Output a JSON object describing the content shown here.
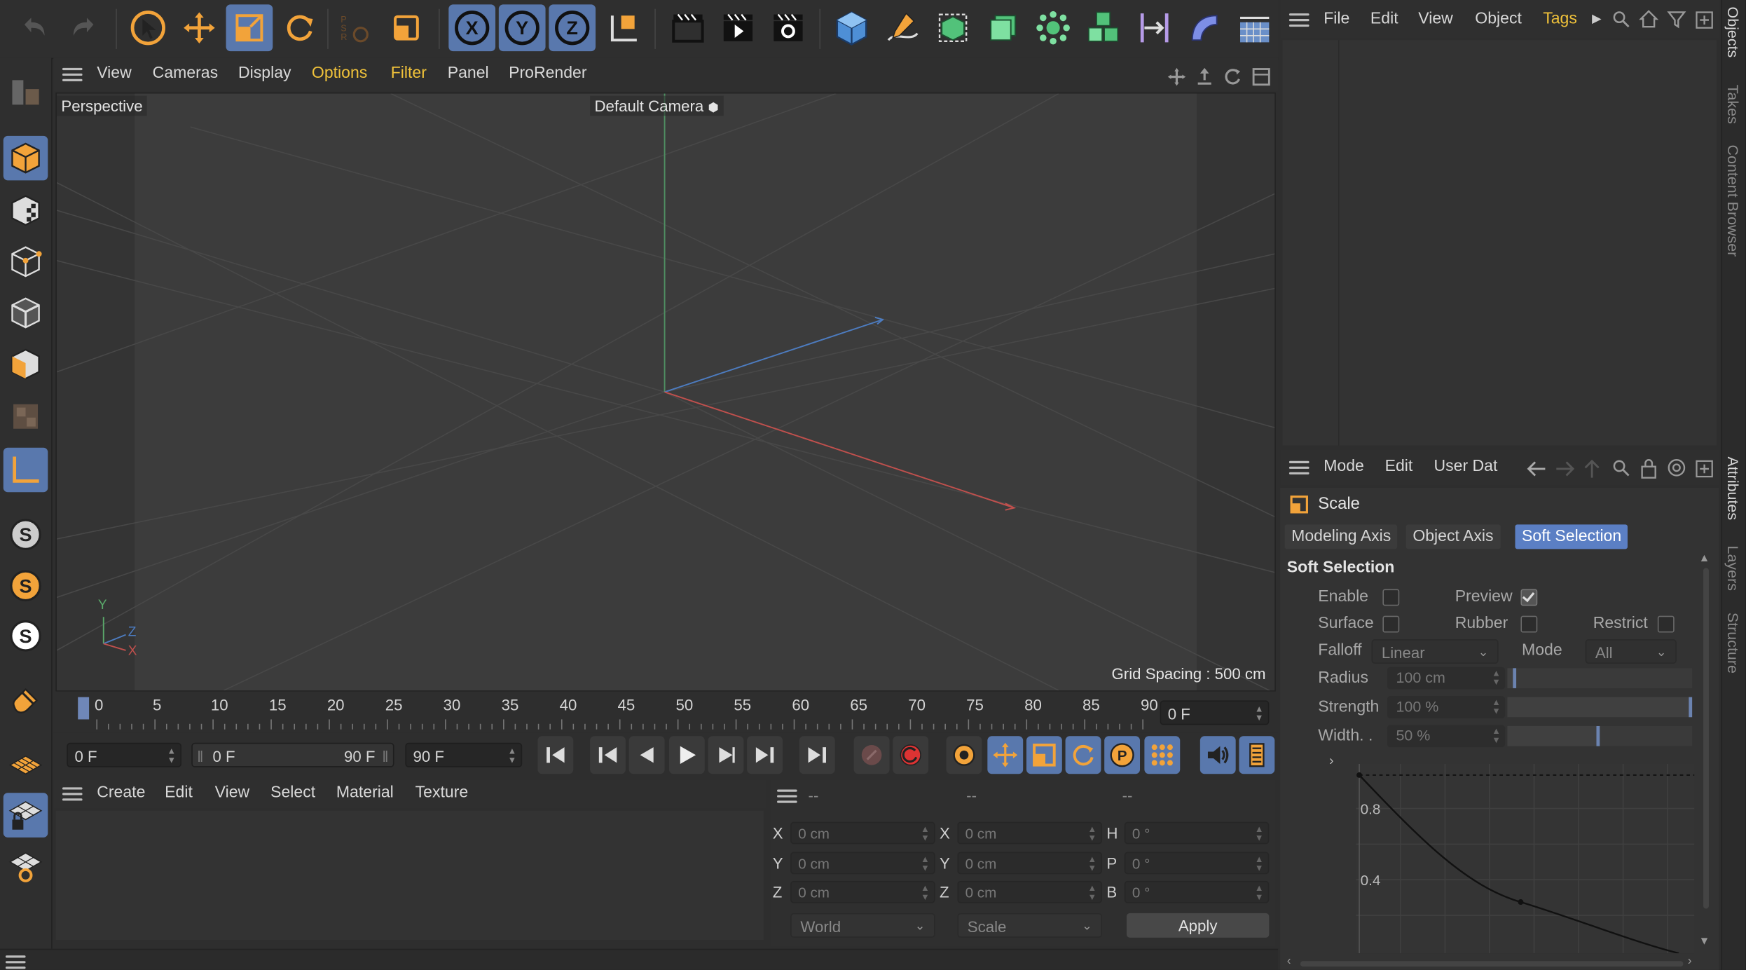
{
  "viewport": {
    "menu": [
      "View",
      "Cameras",
      "Display",
      "Options",
      "Filter",
      "Panel",
      "ProRender"
    ],
    "highlighted_menu": [
      "Options",
      "Filter"
    ],
    "view_name": "Perspective",
    "camera": "Default Camera",
    "grid_spacing": "Grid Spacing : 500 cm",
    "axis_labels": {
      "y": "Y",
      "z": "Z",
      "x": "X"
    }
  },
  "toolbar": {
    "mode_coords": [
      "X",
      "Y",
      "Z"
    ]
  },
  "timeline": {
    "ticks": [
      "0",
      "5",
      "10",
      "15",
      "20",
      "25",
      "30",
      "35",
      "40",
      "45",
      "50",
      "55",
      "60",
      "65",
      "70",
      "75",
      "80",
      "85",
      "90"
    ],
    "current_frame": "0 F"
  },
  "transport": {
    "start": "0 F",
    "range_start": "0 F",
    "range_end": "90 F",
    "end": "90 F"
  },
  "material_manager": {
    "menu": [
      "Create",
      "Edit",
      "View",
      "Select",
      "Material",
      "Texture"
    ]
  },
  "coordinates": {
    "headers": [
      "--",
      "--",
      "--"
    ],
    "rows": [
      {
        "l1": "X",
        "v1": "0 cm",
        "l2": "X",
        "v2": "0 cm",
        "l3": "H",
        "v3": "0 °"
      },
      {
        "l1": "Y",
        "v1": "0 cm",
        "l2": "Y",
        "v2": "0 cm",
        "l3": "P",
        "v3": "0 °"
      },
      {
        "l1": "Z",
        "v1": "0 cm",
        "l2": "Z",
        "v2": "0 cm",
        "l3": "B",
        "v3": "0 °"
      }
    ],
    "space": "World",
    "mode": "Scale",
    "apply": "Apply"
  },
  "object_manager": {
    "menu": [
      "File",
      "Edit",
      "View",
      "Object",
      "Tags"
    ],
    "highlighted_menu": "Tags"
  },
  "attributes": {
    "menu": [
      "Mode",
      "Edit",
      "User Dat"
    ],
    "tool_name": "Scale",
    "tabs": [
      "Modeling Axis",
      "Object Axis",
      "Soft Selection"
    ],
    "active_tab": "Soft Selection",
    "section_title": "Soft Selection",
    "enable_label": "Enable",
    "enable": false,
    "preview_label": "Preview",
    "preview": true,
    "surface_label": "Surface",
    "surface": false,
    "rubber_label": "Rubber",
    "rubber": false,
    "restrict_label": "Restrict",
    "restrict": false,
    "falloff_label": "Falloff",
    "falloff": "Linear",
    "mode_label": "Mode",
    "mode": "All",
    "radius_label": "Radius",
    "radius": "100 cm",
    "radius_level": 0.05,
    "strength_label": "Strength",
    "strength": "100 %",
    "strength_level": 1.0,
    "width_label": "Width. .",
    "width": "50 %",
    "width_level": 0.5,
    "graph_ticks": [
      "0.8",
      "0.4"
    ]
  },
  "side_tabs": [
    "Objects",
    "Takes",
    "Content Browser",
    "Attributes",
    "Layers",
    "Structure"
  ],
  "colors": {
    "accent": "#f0c23a",
    "active_blue": "#5978ad",
    "tool_orange": "#f2a33a",
    "axis_x": "#c0504d",
    "axis_y": "#5aa86a",
    "axis_z": "#4d7cc0"
  }
}
